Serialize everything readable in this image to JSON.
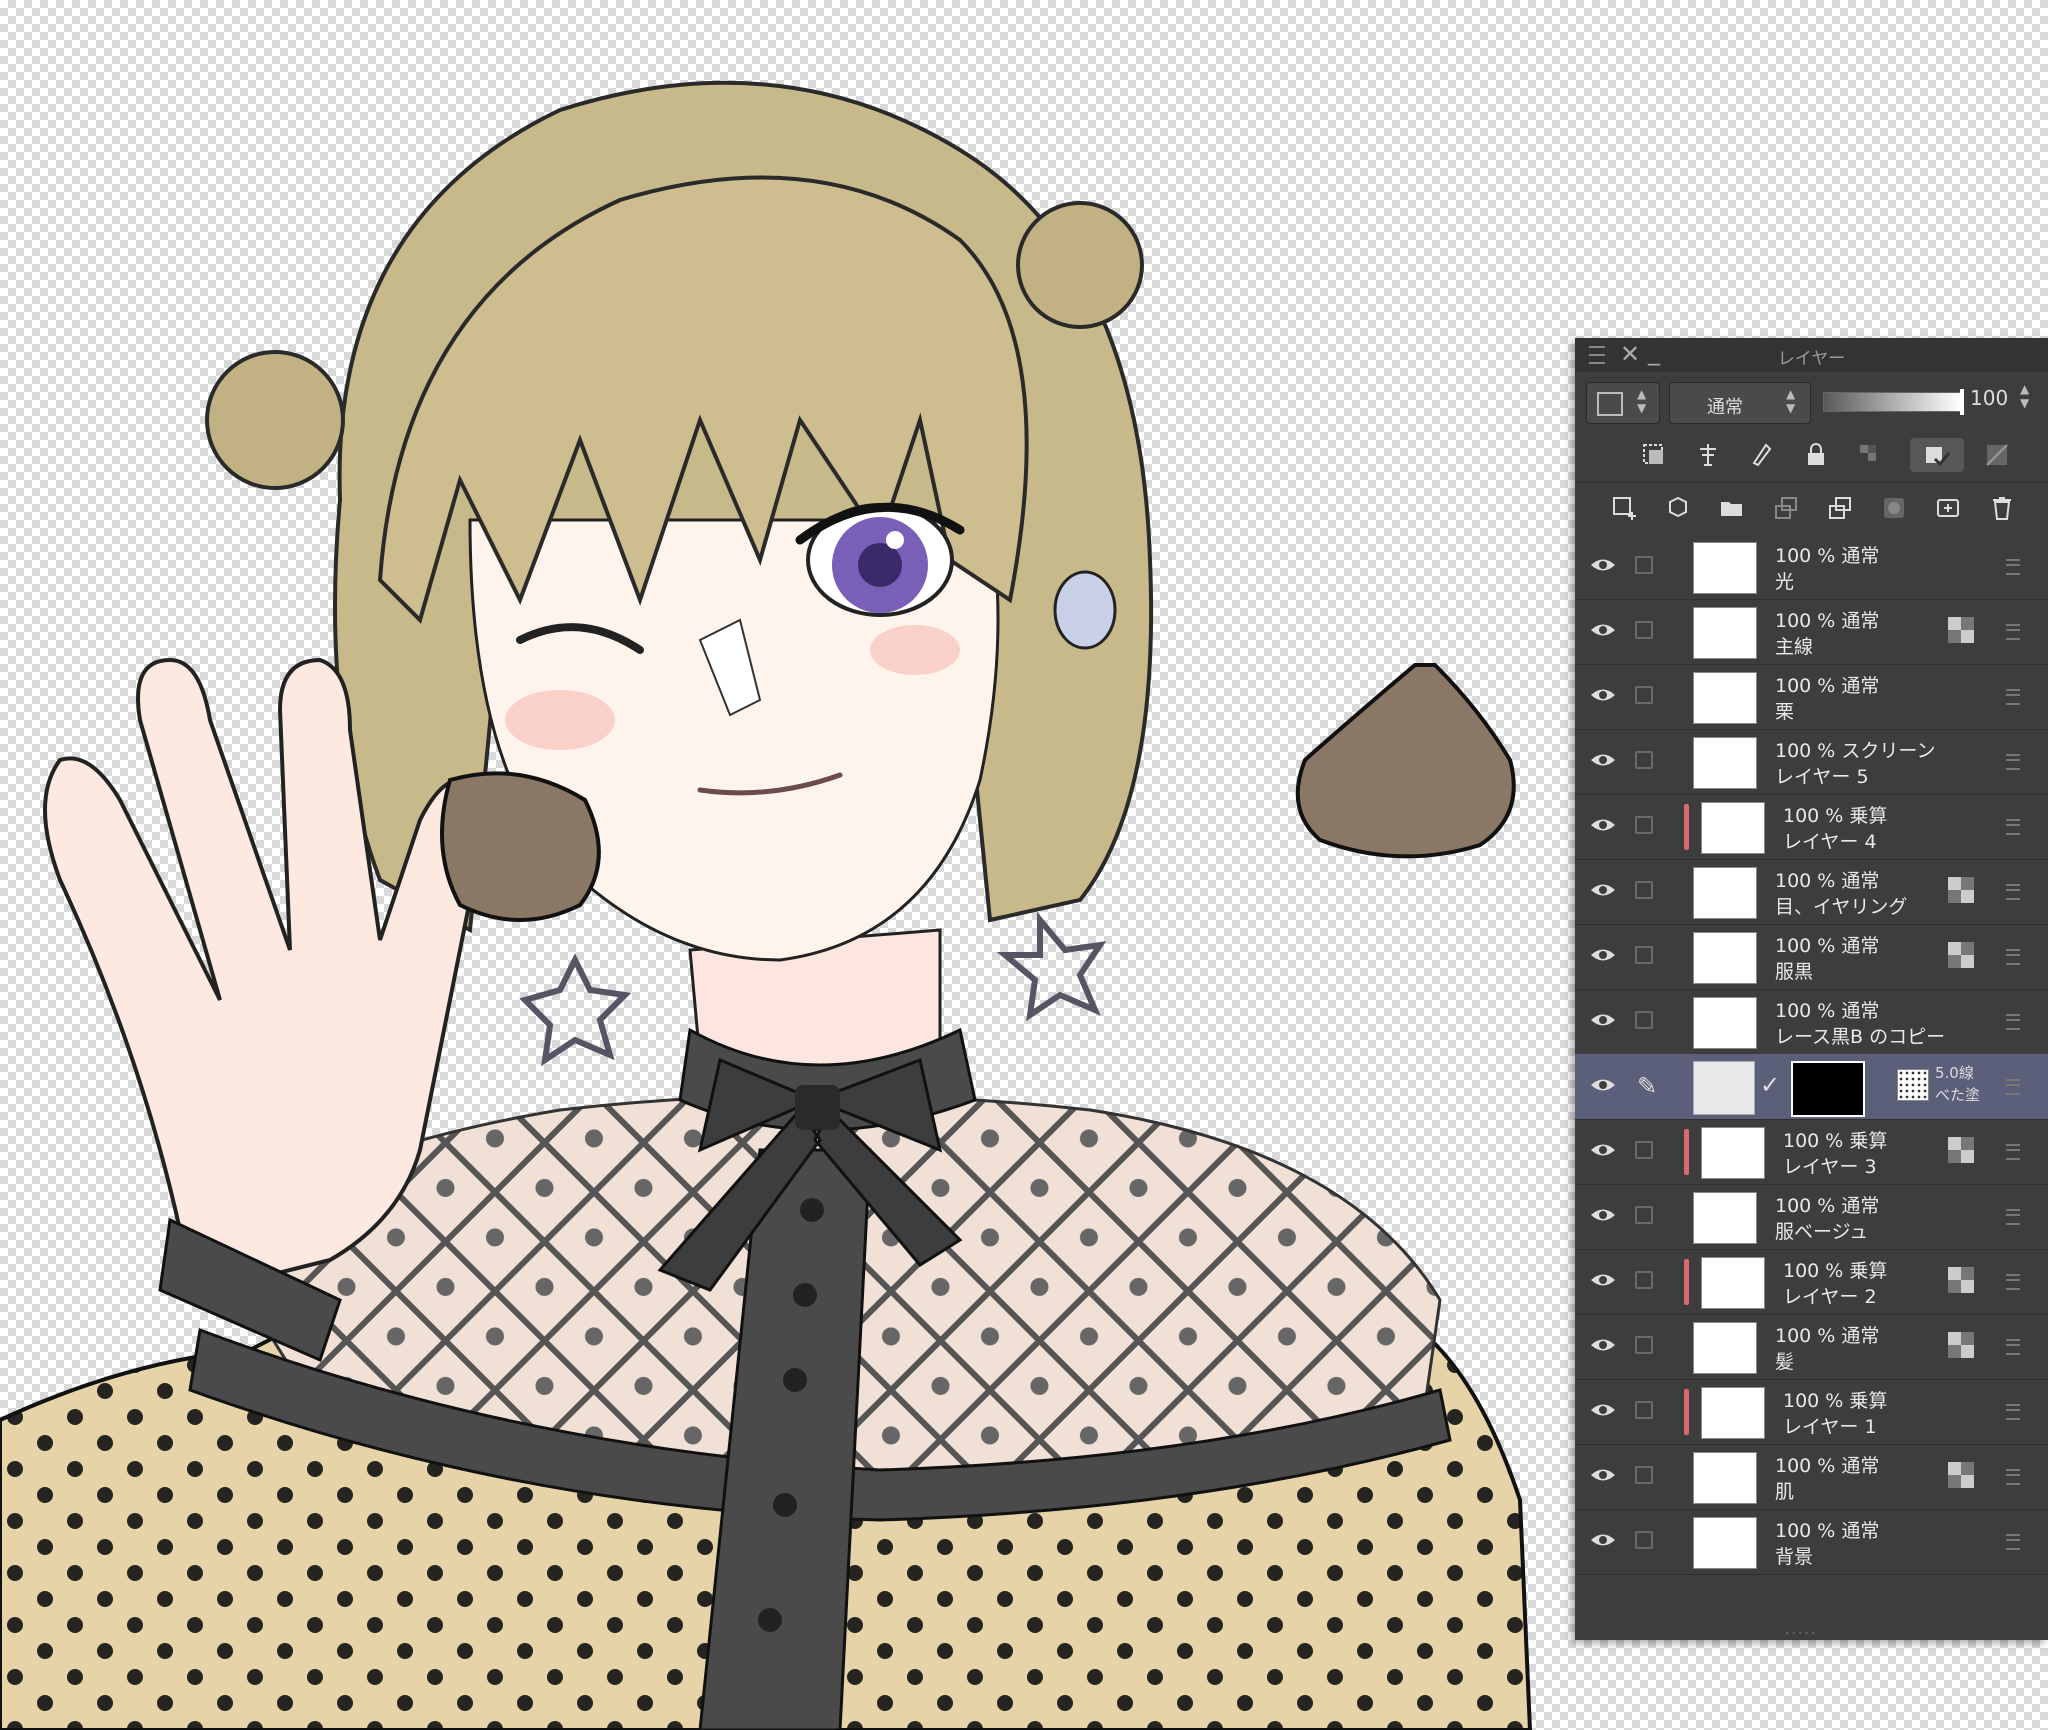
{
  "panel": {
    "title": "レイヤー",
    "blend_mode": "通常",
    "opacity": "100",
    "toolbar_row1": [
      "layer-mask-icon",
      "reference-layer-icon",
      "draft-layer-icon",
      "lock-icon",
      "lock-transparent-icon",
      "clip-to-layer-below-icon",
      "mask-toggle-icon"
    ],
    "toolbar_row2": [
      "new-raster-layer-icon",
      "new-vector-layer-icon",
      "new-folder-icon",
      "transfer-to-layer-below-icon",
      "merge-down-icon",
      "create-mask-icon",
      "apply-mask-icon",
      "delete-layer-icon"
    ]
  },
  "layers": [
    {
      "line1": "100 % 通常",
      "line2": "光",
      "clipped": false,
      "ref": false
    },
    {
      "line1": "100 % 通常",
      "line2": "主線",
      "clipped": false,
      "ref": true
    },
    {
      "line1": "100 % 通常",
      "line2": "栗",
      "clipped": false,
      "ref": false
    },
    {
      "line1": "100 % スクリーン",
      "line2": "レイヤー 5",
      "clipped": false,
      "ref": false
    },
    {
      "line1": "100 % 乗算",
      "line2": "レイヤー 4",
      "clipped": true,
      "ref": false
    },
    {
      "line1": "100 % 通常",
      "line2": "目、イヤリング",
      "clipped": false,
      "ref": true
    },
    {
      "line1": "100 % 通常",
      "line2": "服黒",
      "clipped": false,
      "ref": true
    },
    {
      "line1": "100 % 通常",
      "line2": "レース黒B のコピー",
      "clipped": false,
      "ref": false
    },
    {
      "line1": "5.0線",
      "line2": "べた塗",
      "selected": true
    },
    {
      "line1": "100 % 乗算",
      "line2": "レイヤー 3",
      "clipped": true,
      "ref": true
    },
    {
      "line1": "100 % 通常",
      "line2": "服ベージュ",
      "clipped": false,
      "ref": false
    },
    {
      "line1": "100 % 乗算",
      "line2": "レイヤー 2",
      "clipped": true,
      "ref": true
    },
    {
      "line1": "100 % 通常",
      "line2": "髪",
      "clipped": false,
      "ref": true
    },
    {
      "line1": "100 % 乗算",
      "line2": "レイヤー 1",
      "clipped": true,
      "ref": false
    },
    {
      "line1": "100 % 通常",
      "line2": "肌",
      "clipped": false,
      "ref": true
    },
    {
      "line1": "100 % 通常",
      "line2": "背景",
      "clipped": false,
      "ref": false
    }
  ],
  "colors": {
    "panel_bg": "#3d3d3d",
    "selected_row": "#5b5f7a",
    "clip_bar": "#d9696e",
    "hair": "#c8b98a",
    "blouse": "#e6d3a8",
    "chestnut": "#8b7766"
  }
}
